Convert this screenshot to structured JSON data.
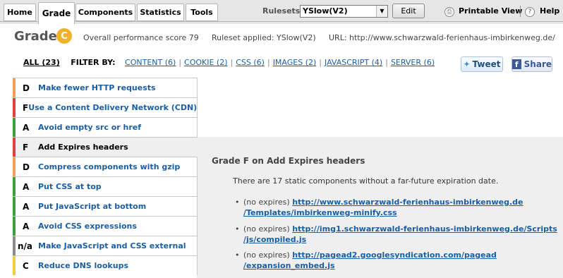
{
  "tabs": [
    {
      "label": "Home",
      "active": false
    },
    {
      "label": "Grade",
      "active": true
    },
    {
      "label": "Components",
      "active": false
    },
    {
      "label": "Statistics",
      "active": false
    },
    {
      "label": "Tools",
      "active": false
    }
  ],
  "toolbar": {
    "ruleset_label": "Rulesets",
    "ruleset_value": "YSlow(V2)",
    "edit_label": "Edit",
    "printable_label": "Printable View",
    "help_label": "Help"
  },
  "summary": {
    "title": "Grade",
    "grade": "C",
    "score_text": "Overall performance score 79",
    "ruleset_text": "Ruleset applied: YSlow(V2)",
    "url_text": "URL: http://www.schwarzwald-ferienhaus-imbirkenweg.de/"
  },
  "filters": {
    "all": "ALL (23)",
    "filter_by": "FILTER BY:",
    "items": [
      "CONTENT (6)",
      "COOKIE (2)",
      "CSS (6)",
      "IMAGES (2)",
      "JAVASCRIPT (4)",
      "SERVER (6)"
    ]
  },
  "social": {
    "tweet": "Tweet",
    "share": "Share"
  },
  "rules": [
    {
      "grade": "D",
      "name": "Make fewer HTTP requests",
      "color": "#f0a050",
      "selected": false
    },
    {
      "grade": "F",
      "name": "Use a Content Delivery Network (CDN)",
      "color": "#e04040",
      "selected": false
    },
    {
      "grade": "A",
      "name": "Avoid empty src or href",
      "color": "#3aa040",
      "selected": false
    },
    {
      "grade": "F",
      "name": "Add Expires headers",
      "color": "#e04040",
      "selected": true
    },
    {
      "grade": "D",
      "name": "Compress components with gzip",
      "color": "#f0a050",
      "selected": false
    },
    {
      "grade": "A",
      "name": "Put CSS at top",
      "color": "#3aa040",
      "selected": false
    },
    {
      "grade": "A",
      "name": "Put JavaScript at bottom",
      "color": "#3aa040",
      "selected": false
    },
    {
      "grade": "A",
      "name": "Avoid CSS expressions",
      "color": "#3aa040",
      "selected": false
    },
    {
      "grade": "n/a",
      "name": "Make JavaScript and CSS external",
      "color": "#8a8a8a",
      "selected": false
    },
    {
      "grade": "C",
      "name": "Reduce DNS lookups",
      "color": "#f0d040",
      "selected": false
    }
  ],
  "detail": {
    "title": "Grade F on Add Expires headers",
    "description": "There are 17 static components without a far-future expiration date.",
    "items": [
      {
        "prefix": "(no expires)",
        "line1": "http://www.schwarzwald-ferienhaus-imbirkenweg.de",
        "line2": "/Templates/imbirkenweg-minify.css"
      },
      {
        "prefix": "(no expires)",
        "line1": "http://img1.schwarzwald-ferienhaus-imbirkenweg.de/Scripts",
        "line2": "/js/compiled.js"
      },
      {
        "prefix": "(no expires)",
        "line1": "http://pagead2.googlesyndication.com/pagead",
        "line2": "/expansion_embed.js"
      }
    ]
  }
}
